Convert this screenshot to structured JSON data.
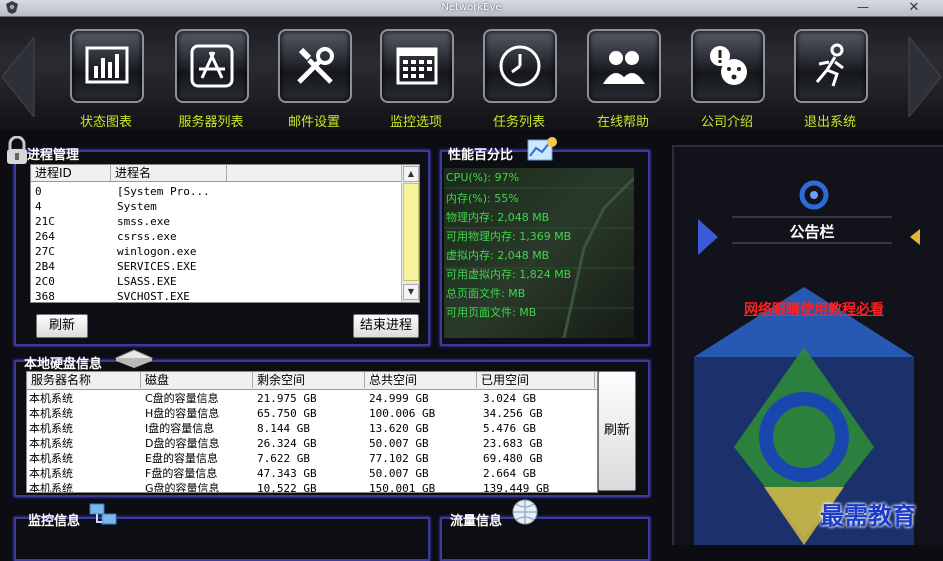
{
  "window": {
    "title": "NetworkEye",
    "minimize": "—",
    "close": "✕"
  },
  "toolbar": [
    {
      "label": "状态图表",
      "icon": "bar-chart-icon"
    },
    {
      "label": "服务器列表",
      "icon": "appstore-icon"
    },
    {
      "label": "邮件设置",
      "icon": "tools-icon"
    },
    {
      "label": "监控选项",
      "icon": "calendar-icon"
    },
    {
      "label": "任务列表",
      "icon": "clock-icon"
    },
    {
      "label": "在线帮助",
      "icon": "users-icon"
    },
    {
      "label": "公司介绍",
      "icon": "chat-icon"
    },
    {
      "label": "退出系统",
      "icon": "running-man-icon"
    }
  ],
  "process": {
    "title": "进程管理",
    "columns": [
      "进程ID",
      "进程名"
    ],
    "rows": [
      [
        "0",
        "[System Pro..."
      ],
      [
        "4",
        "System"
      ],
      [
        "21C",
        "smss.exe"
      ],
      [
        "264",
        "csrss.exe"
      ],
      [
        "27C",
        "winlogon.exe"
      ],
      [
        "2B4",
        "SERVICES.EXE"
      ],
      [
        "2C0",
        "LSASS.EXE"
      ],
      [
        "368",
        "SVCHOST.EXE"
      ]
    ],
    "refresh": "刷新",
    "kill": "结束进程"
  },
  "perf": {
    "title": "性能百分比",
    "lines": [
      "CPU(%):   97%",
      "内存(%):     55%",
      "物理内存: 2,048 MB",
      "可用物理内存: 1,369 MB",
      "虚拟内存: 2,048 MB",
      "可用虚拟内存: 1,824 MB",
      "总页面文件:   MB",
      "可用页面文件:  MB"
    ]
  },
  "bulletin": {
    "title": "公告栏",
    "link": "网络眼睛使用教程必看"
  },
  "disk": {
    "title": "本地硬盘信息",
    "columns": [
      "服务器名称",
      "磁盘",
      "剩余空间",
      "总共空间",
      "已用空间"
    ],
    "rows": [
      [
        "本机系统",
        "C盘的容量信息",
        "21.975 GB",
        "24.999 GB",
        "3.024 GB"
      ],
      [
        "本机系统",
        "H盘的容量信息",
        "65.750 GB",
        "100.006 GB",
        "34.256 GB"
      ],
      [
        "本机系统",
        "I盘的容量信息",
        "8.144 GB",
        "13.620 GB",
        "5.476 GB"
      ],
      [
        "本机系统",
        "D盘的容量信息",
        "26.324 GB",
        "50.007 GB",
        "23.683 GB"
      ],
      [
        "本机系统",
        "E盘的容量信息",
        "7.622 GB",
        "77.102 GB",
        "69.480 GB"
      ],
      [
        "本机系统",
        "F盘的容量信息",
        "47.343 GB",
        "50.007 GB",
        "2.664 GB"
      ],
      [
        "本机系统",
        "G盘的容量信息",
        "10.522 GB",
        "150.001 GB",
        "139.449 GB"
      ]
    ],
    "refresh": "刷新"
  },
  "monitor": {
    "title": "监控信息"
  },
  "traffic": {
    "title": "流量信息"
  },
  "watermark": "最需教育",
  "colors": {
    "accent_label": "#c9e626",
    "panel_border": "#3b3aa0",
    "perf_text": "#3fd64a",
    "link_red": "#ff2020"
  }
}
